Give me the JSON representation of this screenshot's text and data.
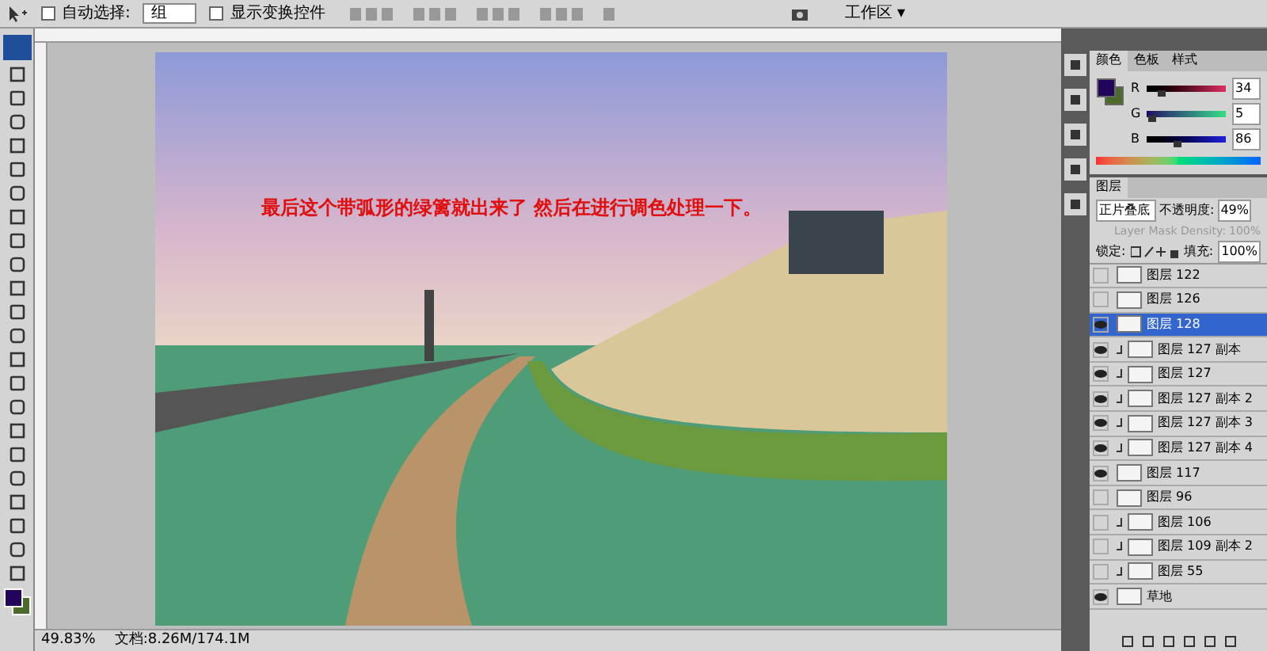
{
  "options_bar": {
    "auto_select": {
      "label": "自动选择:",
      "checked": false
    },
    "auto_select_target": "组",
    "show_transform": {
      "label": "显示变换控件",
      "checked": false
    },
    "workspace": "工作区 ▾"
  },
  "canvas": {
    "caption": "最后这个带弧形的绿篱就出来了 然后在进行调色处理一下。"
  },
  "color_panel": {
    "tabs": [
      {
        "label": "颜色",
        "selected": true
      },
      {
        "label": "色板",
        "selected": false
      },
      {
        "label": "样式",
        "selected": false
      }
    ],
    "channels": [
      {
        "name": "R",
        "value": "34",
        "level": 0.13
      },
      {
        "name": "G",
        "value": "5",
        "level": 0.02
      },
      {
        "name": "B",
        "value": "86",
        "level": 0.34
      }
    ]
  },
  "layers_panel": {
    "tab": "图层",
    "blend_mode": "正片叠底",
    "opacity_label": "不透明度:",
    "opacity": "49%",
    "mask_density_label": "Layer Mask Density:",
    "mask_density": "100%",
    "lock_label": "锁定:",
    "fill_label": "填充:",
    "fill": "100%",
    "layers": [
      {
        "name": "图层 122",
        "visible": false,
        "selected": false,
        "clipped": false
      },
      {
        "name": "图层 126",
        "visible": false,
        "selected": false,
        "clipped": false
      },
      {
        "name": "图层 128",
        "visible": true,
        "selected": true,
        "clipped": false
      },
      {
        "name": "图层 127 副本",
        "visible": true,
        "selected": false,
        "clipped": true
      },
      {
        "name": "图层 127",
        "visible": true,
        "selected": false,
        "clipped": true
      },
      {
        "name": "图层 127 副本 2",
        "visible": true,
        "selected": false,
        "clipped": true
      },
      {
        "name": "图层 127 副本 3",
        "visible": true,
        "selected": false,
        "clipped": true
      },
      {
        "name": "图层 127 副本 4",
        "visible": true,
        "selected": false,
        "clipped": true
      },
      {
        "name": "图层 117",
        "visible": true,
        "selected": false,
        "clipped": false
      },
      {
        "name": "图层 96",
        "visible": false,
        "selected": false,
        "clipped": false
      },
      {
        "name": "图层 106",
        "visible": false,
        "selected": false,
        "clipped": true
      },
      {
        "name": "图层 109 副本 2",
        "visible": false,
        "selected": false,
        "clipped": true
      },
      {
        "name": "图层 55",
        "visible": false,
        "selected": false,
        "clipped": true
      },
      {
        "name": "草地",
        "visible": true,
        "selected": false,
        "clipped": false
      }
    ]
  },
  "status_bar": {
    "zoom": "49.83%",
    "doc": "文档:8.26M/174.1M"
  }
}
